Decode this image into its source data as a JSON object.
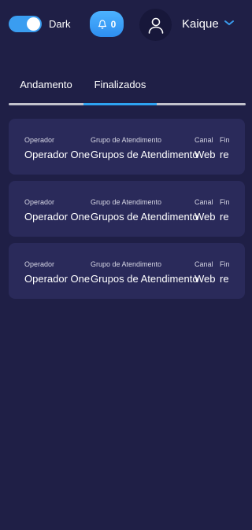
{
  "header": {
    "theme_label": "Dark",
    "notifications_count": "0",
    "user_name": "Kaique",
    "accent_color": "#3a9df0"
  },
  "tabs": [
    {
      "label": "Andamento",
      "active": false
    },
    {
      "label": "Finalizados",
      "active": true
    }
  ],
  "cards": [
    {
      "operador_label": "Operador",
      "operador": "Operador One",
      "grupo_label": "Grupo de Atendimento",
      "grupo": "Grupos de Atendimento",
      "canal_label": "Canal",
      "canal": "Web",
      "fin_label": "Fin",
      "fin": "re"
    },
    {
      "operador_label": "Operador",
      "operador": "Operador One",
      "grupo_label": "Grupo de Atendimento",
      "grupo": "Grupos de Atendimento",
      "canal_label": "Canal",
      "canal": "Web",
      "fin_label": "Fin",
      "fin": "re"
    },
    {
      "operador_label": "Operador",
      "operador": "Operador One",
      "grupo_label": "Grupo de Atendimento",
      "grupo": "Grupos de Atendimento",
      "canal_label": "Canal",
      "canal": "Web",
      "fin_label": "Fin",
      "fin": "re"
    }
  ]
}
